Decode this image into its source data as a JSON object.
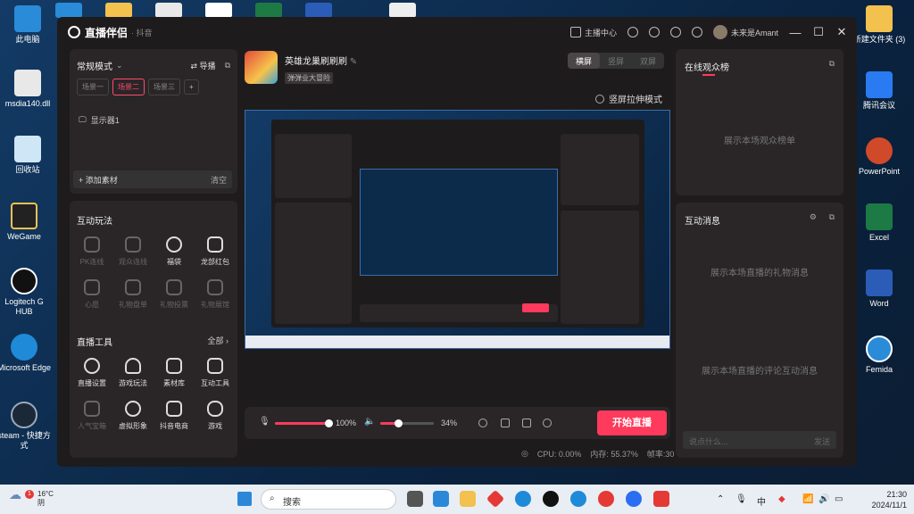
{
  "desktop": {
    "left_icons": [
      {
        "label": "此电脑",
        "color": "#2a8bd8"
      },
      {
        "label": "msdia140.dll",
        "color": "#e8e8e8"
      },
      {
        "label": "回收站",
        "color": "#cfe6f7"
      },
      {
        "label": "WeGame",
        "color": "#222"
      },
      {
        "label": "Logitech G HUB",
        "color": "#111"
      },
      {
        "label": "Microsoft Edge",
        "color": "#1f8ad8"
      },
      {
        "label": "steam - 快捷方式",
        "color": "#1b2838"
      }
    ],
    "right_icons": [
      {
        "label": "新建文件夹 (3)",
        "color": "#f2c14e"
      },
      {
        "label": "腾讯会议",
        "color": "#2a7bf2"
      },
      {
        "label": "PowerPoint",
        "color": "#d04a2a"
      },
      {
        "label": "Excel",
        "color": "#1d7a45"
      },
      {
        "label": "Word",
        "color": "#2b5cb8"
      },
      {
        "label": "Femida",
        "color": "#2a8bd8"
      }
    ]
  },
  "app": {
    "title": "直播伴侣",
    "subtitle": "· 抖音",
    "header": {
      "anchor_center": "主播中心",
      "username": "未来是Amant"
    }
  },
  "scene_panel": {
    "mode": "常规模式",
    "import_label": "导播",
    "scenes": [
      "场景一",
      "场景二",
      "场景三"
    ],
    "active_scene_index": 1,
    "sources": [
      "显示器1"
    ],
    "add_material": "添加素材",
    "clear": "清空"
  },
  "interactive": {
    "title": "互动玩法",
    "items": [
      {
        "label": "PK连线",
        "enabled": false
      },
      {
        "label": "观众连线",
        "enabled": false
      },
      {
        "label": "福袋",
        "enabled": true
      },
      {
        "label": "龙部红包",
        "enabled": true
      },
      {
        "label": "心愿",
        "enabled": false
      },
      {
        "label": "礼物盘单",
        "enabled": false
      },
      {
        "label": "礼物投票",
        "enabled": false
      },
      {
        "label": "礼物展馆",
        "enabled": false
      }
    ]
  },
  "live_tools": {
    "title": "直播工具",
    "all_label": "全部",
    "items": [
      {
        "label": "直播设置",
        "enabled": true
      },
      {
        "label": "游戏玩法",
        "enabled": true
      },
      {
        "label": "素材库",
        "enabled": true
      },
      {
        "label": "互动工具",
        "enabled": true
      },
      {
        "label": "人气宝箱",
        "enabled": false
      },
      {
        "label": "虚拟形象",
        "enabled": true
      },
      {
        "label": "抖音电商",
        "enabled": true
      },
      {
        "label": "游戏",
        "enabled": true
      }
    ]
  },
  "stream": {
    "game_name": "英雄龙巢刷刷刷",
    "game_tag": "弹弹业大冒险",
    "orientation_options": [
      "横屏",
      "竖屏",
      "双屏"
    ],
    "active_orientation_index": 0,
    "portrait_stretch": "竖屏拉伸模式"
  },
  "controls": {
    "mic_volume_pct": 100,
    "mic_volume_label": "100%",
    "speaker_volume_pct": 34,
    "speaker_volume_label": "34%",
    "start_button": "开始直播"
  },
  "status": {
    "cpu": "CPU: 0.00%",
    "memory": "内存: 55.37%",
    "fps": "帧率:30"
  },
  "audience": {
    "title": "在线观众榜",
    "empty": "展示本场观众榜单"
  },
  "messages": {
    "title": "互动消息",
    "gift_empty": "展示本场直播的礼物消息",
    "comment_empty": "展示本场直播的评论互动消息",
    "input_placeholder": "说点什么...",
    "send": "发送"
  },
  "taskbar": {
    "weather_temp": "16°C",
    "weather_desc": "阴",
    "weather_badge": "1",
    "search_placeholder": "搜索",
    "ime": "中",
    "time": "21:30",
    "date": "2024/11/1",
    "app_colors": [
      "#2b88d8",
      "#f2c14e",
      "#e53935",
      "#1f8ad8",
      "#111",
      "#1f8ad8",
      "#e53935",
      "#2b6ef2",
      "#e53935"
    ]
  }
}
